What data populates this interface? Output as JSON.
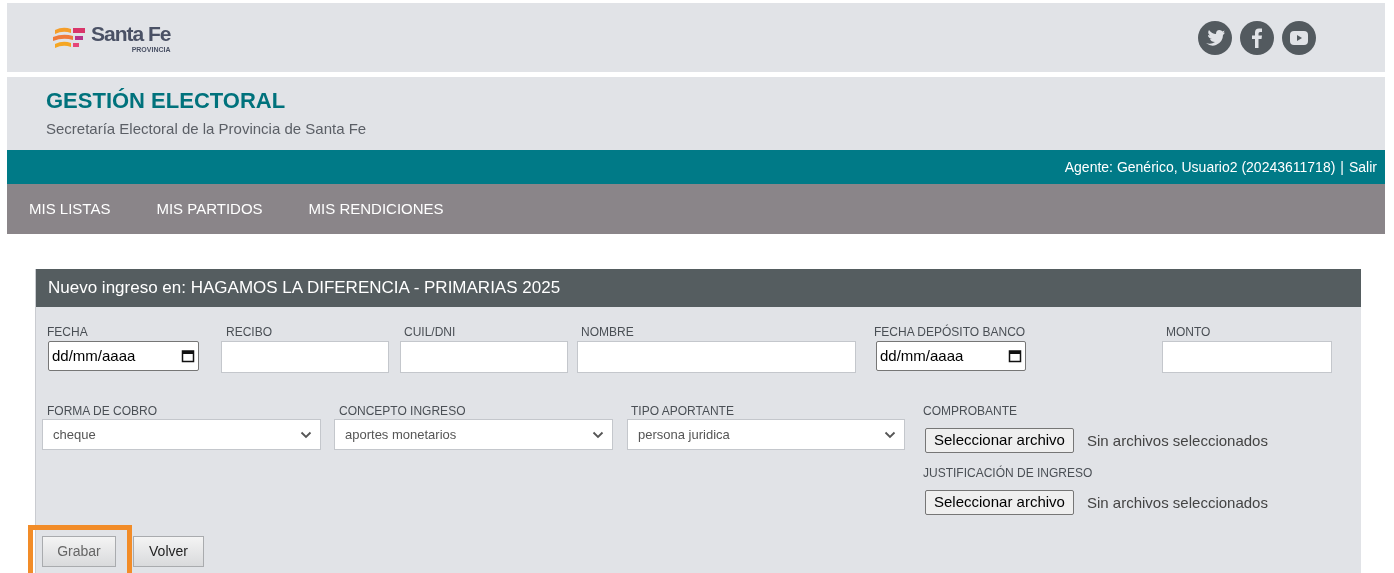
{
  "header": {
    "logo_text": "Santa Fe",
    "logo_subtext": "PROVINCIA"
  },
  "title": {
    "heading": "GESTIÓN ELECTORAL",
    "subheading": "Secretaría Electoral de la Provincia de Santa Fe"
  },
  "user_bar": {
    "agent": "Agente: Genérico, Usuario2 (20243611718)",
    "separator": "|",
    "logout": "Salir"
  },
  "nav": [
    "MIS LISTAS",
    "MIS PARTIDOS",
    "MIS RENDICIONES"
  ],
  "form": {
    "title": "Nuevo ingreso en: HAGAMOS LA DIFERENCIA - PRIMARIAS 2025",
    "row_1": [
      {
        "kind": "date",
        "label": "FECHA",
        "placeholder": "dd/mm/aaaa"
      },
      {
        "kind": "text",
        "label": "RECIBO"
      },
      {
        "kind": "text",
        "label": "CUIL/DNI"
      },
      {
        "kind": "text",
        "label": "NOMBRE"
      },
      {
        "kind": "date",
        "label": "FECHA DEPÓSITO BANCO",
        "placeholder": "dd/mm/aaaa"
      },
      {
        "kind": "text",
        "label": "MONTO"
      }
    ],
    "row_2": [
      {
        "kind": "select",
        "label": "FORMA DE COBRO",
        "value": "cheque"
      },
      {
        "kind": "select",
        "label": "CONCEPTO INGRESO",
        "value": "aportes monetarios"
      },
      {
        "kind": "select",
        "label": "TIPO APORTANTE",
        "value": "persona juridica"
      }
    ],
    "files": [
      {
        "label": "COMPROBANTE",
        "button": "Seleccionar archivo",
        "status": "Sin archivos seleccionados"
      },
      {
        "label": "JUSTIFICACIÓN DE INGRESO",
        "button": "Seleccionar archivo",
        "status": "Sin archivos seleccionados"
      }
    ],
    "buttons": [
      {
        "label": "Grabar",
        "highlighted": true
      },
      {
        "label": "Volver",
        "highlighted": false
      }
    ]
  }
}
